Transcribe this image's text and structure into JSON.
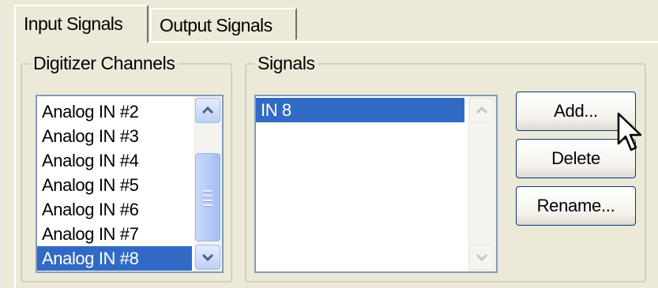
{
  "tabs": [
    {
      "label": "Input Signals",
      "active": true
    },
    {
      "label": "Output Signals",
      "active": false
    }
  ],
  "digitizer": {
    "title": "Digitizer Channels",
    "items": [
      "Analog IN #2",
      "Analog IN #3",
      "Analog IN #4",
      "Analog IN #5",
      "Analog IN #6",
      "Analog IN #7",
      "Analog IN #8"
    ],
    "selected": "Analog IN #8"
  },
  "signals": {
    "title": "Signals",
    "items": [
      "IN 8"
    ],
    "selected": "IN 8"
  },
  "buttons": {
    "add": "Add...",
    "delete": "Delete",
    "rename": "Rename..."
  },
  "colors": {
    "selection": "#316ac5",
    "face": "#ece9d8",
    "list_border": "#7f9db9"
  },
  "icons": [
    "scroll-up-arrow-icon",
    "scroll-down-arrow-icon",
    "mouse-pointer-icon"
  ]
}
